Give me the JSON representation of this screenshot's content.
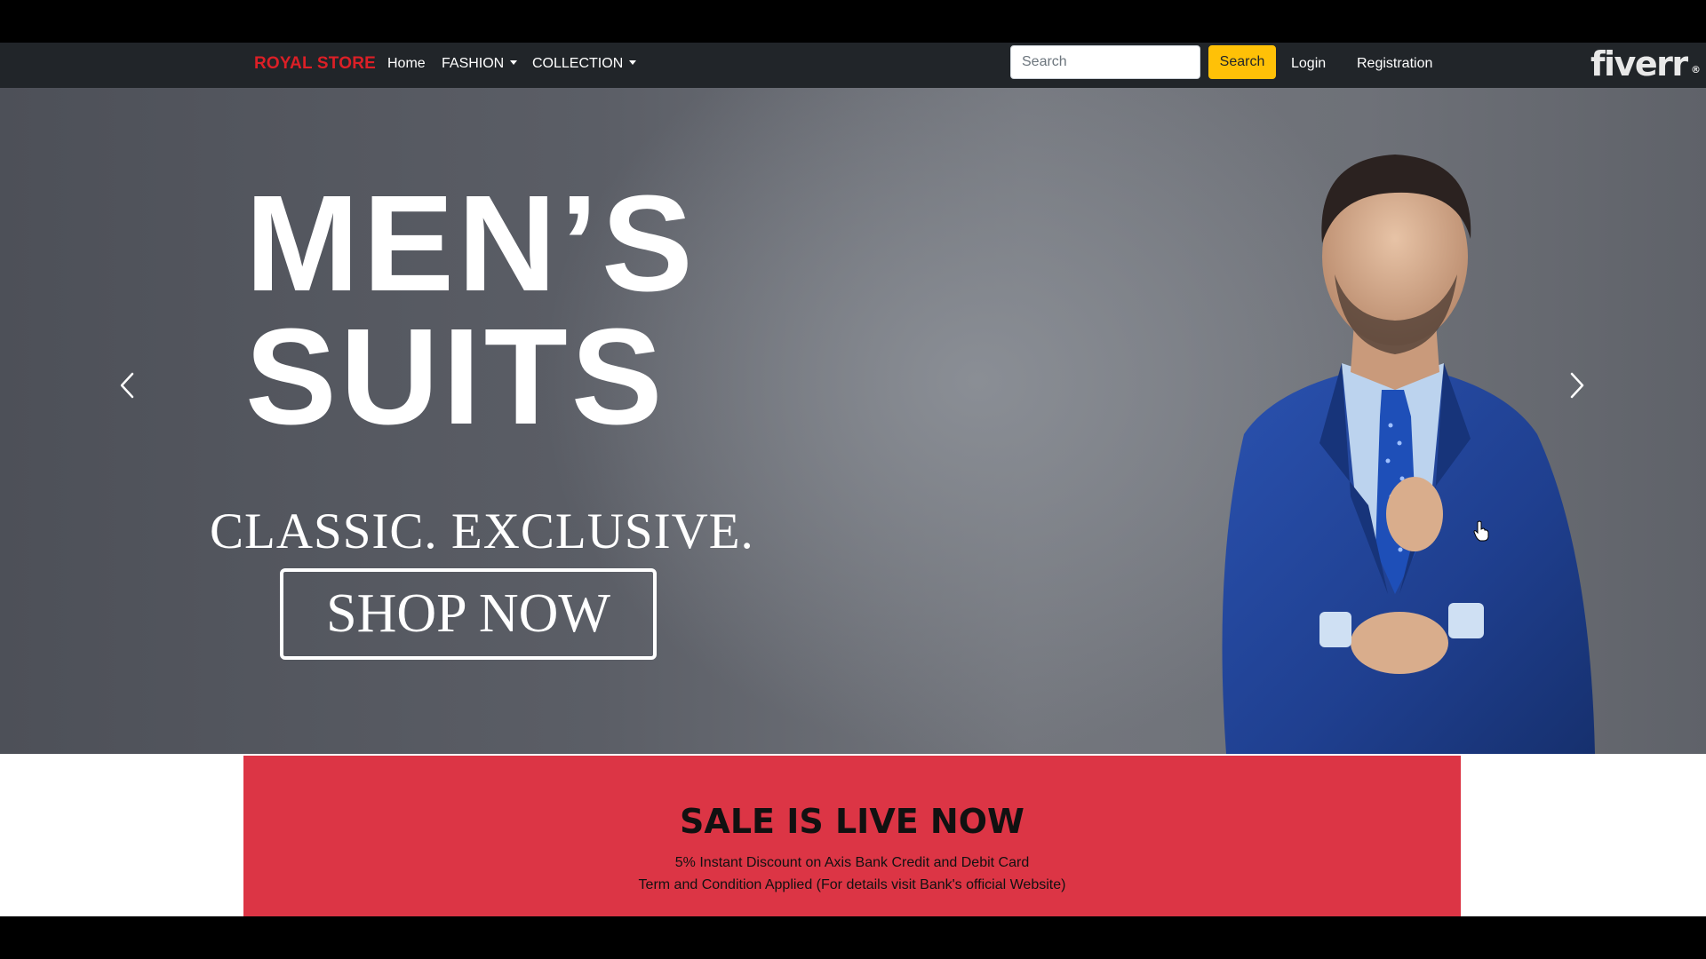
{
  "navbar": {
    "brand": "ROYAL STORE",
    "links": [
      {
        "label": "Home"
      },
      {
        "label": "FASHION"
      },
      {
        "label": "COLLECTION"
      }
    ],
    "search": {
      "placeholder": "Search",
      "value": "",
      "button_label": "Search"
    },
    "login_label": "Login",
    "registration_label": "Registration",
    "watermark": "fiverr",
    "watermark_mark": "®"
  },
  "hero": {
    "title": "MEN’S\nSUITS",
    "subtitle": "CLASSIC. EXCLUSIVE.",
    "cta_label": "SHOP NOW",
    "prev_icon": "chevron-left-icon",
    "next_icon": "chevron-right-icon"
  },
  "sale": {
    "heading": "SALE IS LIVE NOW",
    "line1": "5% Instant Discount on Axis Bank Credit and Debit Card",
    "line2": "Term and Condition Applied (For details visit Bank's official Website)"
  },
  "colors": {
    "navbar": "#212529",
    "brand": "#dc1f26",
    "search_button": "#ffc107",
    "sale_banner": "#dc3545",
    "suit": "#1f3f8f"
  }
}
